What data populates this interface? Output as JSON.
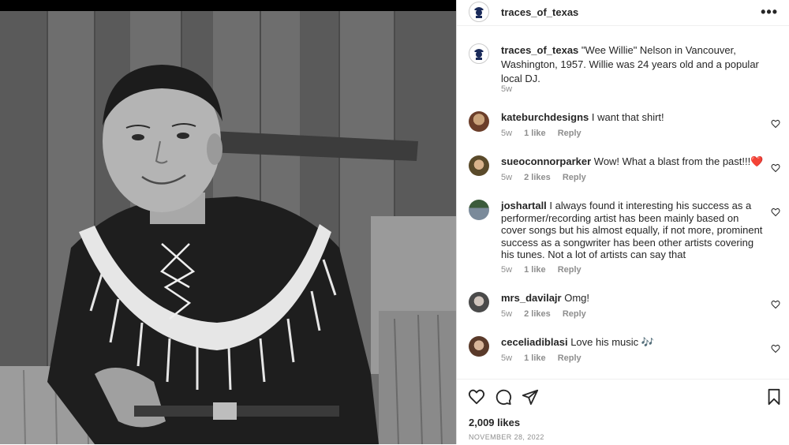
{
  "post": {
    "author": "traces_of_texas",
    "caption": "\"Wee Willie\" Nelson in Vancouver, Washington, 1957. Willie was 24 years old and a popular local DJ.",
    "caption_age": "5w",
    "more_label": "•••",
    "likes": "2,009 likes",
    "date": "NOVEMBER 28, 2022"
  },
  "comments": [
    {
      "user": "kateburchdesigns",
      "text": "I want that shirt!",
      "age": "5w",
      "likes": "1 like",
      "reply": "Reply"
    },
    {
      "user": "sueoconnorparker",
      "text": "Wow! What a blast from the past!!!❤️",
      "age": "5w",
      "likes": "2 likes",
      "reply": "Reply"
    },
    {
      "user": "joshartall",
      "text": "I always found it interesting his success as a performer/recording artist has been mainly based on cover songs but his almost equally, if not more, prominent success as a songwriter has been other artists covering his tunes. Not a lot of artists can say that",
      "age": "5w",
      "likes": "1 like",
      "reply": "Reply"
    },
    {
      "user": "mrs_davilajr",
      "text": "Omg!",
      "age": "5w",
      "likes": "2 likes",
      "reply": "Reply"
    },
    {
      "user": "ceceliadiblasi",
      "text": "Love his music 🎶",
      "age": "5w",
      "likes": "1 like",
      "reply": "Reply"
    }
  ],
  "colors": {
    "text": "#262626",
    "meta": "#8e8e8e",
    "border": "#dbdbdb"
  },
  "icons": [
    "heart-icon",
    "comment-icon",
    "share-icon",
    "bookmark-icon",
    "more-options-icon"
  ]
}
